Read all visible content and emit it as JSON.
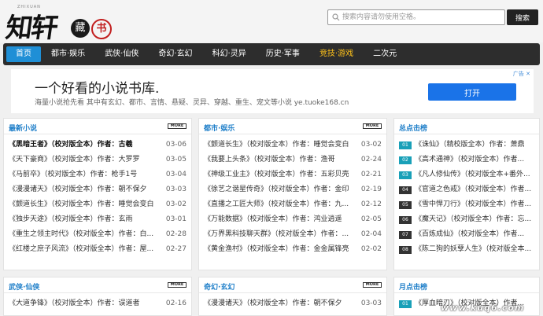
{
  "logo": {
    "small_text": "ZHIXUAN",
    "main_text": "知轩",
    "seal1": "藏",
    "seal2": "书"
  },
  "search": {
    "placeholder": "搜索内容请勿使用空格。",
    "button_label": "搜索"
  },
  "nav": {
    "items": [
      {
        "label": "首页",
        "state": "active"
      },
      {
        "label": "都市·娱乐",
        "state": "normal"
      },
      {
        "label": "武侠·仙侠",
        "state": "normal"
      },
      {
        "label": "奇幻·玄幻",
        "state": "normal"
      },
      {
        "label": "科幻·灵异",
        "state": "normal"
      },
      {
        "label": "历史·军事",
        "state": "normal"
      },
      {
        "label": "竞技·游戏",
        "state": "highlight"
      },
      {
        "label": "二次元",
        "state": "normal"
      }
    ]
  },
  "ad": {
    "title": "一个好看的小说书库.",
    "subtitle": "海量小说抢先看 其中有玄幻、都市、言情、悬疑、灵异、穿越、重生、宠文等小说 ye.tuoke168.cn",
    "button_label": "打开",
    "badge": "广告 ✕"
  },
  "panels": {
    "latest": {
      "title": "最新小说",
      "more": "MORE",
      "items": [
        {
          "text": "《黑暗王者》（校对版全本）作者：古羲",
          "date": "03-06"
        },
        {
          "text": "《天下豪商》（校对版全本）作者：大罗罗",
          "date": "03-05"
        },
        {
          "text": "《马前卒》（校对版全本）作者：枪手1号",
          "date": "03-04"
        },
        {
          "text": "《漫漫诸天》（校对版全本）作者：朝不保夕",
          "date": "03-03"
        },
        {
          "text": "《颤道长生》（校对版全本）作者：睡觉会变白",
          "date": "03-02"
        },
        {
          "text": "《独步天途》（校对版全本）作者：玄雨",
          "date": "03-01"
        },
        {
          "text": "《重生之领主时代》（校对版全本）作者：白...",
          "date": "02-28"
        },
        {
          "text": "《红楼之庶子风流》（校对版全本）作者：屋...",
          "date": "02-27"
        }
      ]
    },
    "urban": {
      "title": "都市·娱乐",
      "more": "MORE",
      "items": [
        {
          "text": "《颤道长生》（校对版全本）作者：睡觉会变白",
          "date": "03-02"
        },
        {
          "text": "《我要上头条》（校对版全本）作者：渔哥",
          "date": "02-24"
        },
        {
          "text": "《神级工业主》（校对版全本）作者：五彩贝壳",
          "date": "02-21"
        },
        {
          "text": "《徐艺之谐星传奇》（校对版全本）作者：金印",
          "date": "02-19"
        },
        {
          "text": "《直播之工匠大师》（校对版全本）作者：九...",
          "date": "02-12"
        },
        {
          "text": "《万能数据》（校对版全本）作者：鸿业逍遥",
          "date": "02-05"
        },
        {
          "text": "《万界黑科技聊天群》（校对版全本）作者：...",
          "date": "02-04"
        },
        {
          "text": "《黄金渔村》（校对版全本）作者：金金属锋亮",
          "date": "02-02"
        }
      ]
    },
    "hot": {
      "title": "总点击榜",
      "items": [
        {
          "num": "01",
          "text": "《诛仙》（精校版全本）作者：萧鼎"
        },
        {
          "num": "02",
          "text": "《高术通神》（校对版全本）作者..."
        },
        {
          "num": "03",
          "text": "《凡人修仙传》（校对版全本+番外..."
        },
        {
          "num": "04",
          "text": "《官道之色戒》（校对版全本）作者..."
        },
        {
          "num": "05",
          "text": "《雪中悍刀行》（校对版全本）作者..."
        },
        {
          "num": "06",
          "text": "《魔天记》（校对版全本）作者：忘..."
        },
        {
          "num": "07",
          "text": "《百炼成仙》（校对版全本）作者..."
        },
        {
          "num": "08",
          "text": "《陈二狗的妖孽人生》（校对版全本..."
        }
      ]
    },
    "wuxia": {
      "title": "武侠·仙侠",
      "more": "MORE",
      "items": [
        {
          "text": "《大道争锋》（校对版全本）作者：误道者",
          "date": "02-16"
        }
      ]
    },
    "fantasy": {
      "title": "奇幻·玄幻",
      "more": "MORE",
      "items": [
        {
          "text": "《漫漫诸天》（校对版全本）作者：朝不保夕",
          "date": "03-03"
        }
      ]
    },
    "monthly": {
      "title": "月点击榜",
      "items": [
        {
          "num": "01",
          "text": "《厚血暗刃》（校对版全本）作者..."
        }
      ]
    }
  },
  "watermark": "www.kuq6.com",
  "colors": {
    "accent": "#1f8fd6",
    "nav_bg": "#2d2d2d",
    "highlight": "#ffc21a",
    "title_blue": "#1f7fc9",
    "rank_top": "#19a0b8"
  }
}
